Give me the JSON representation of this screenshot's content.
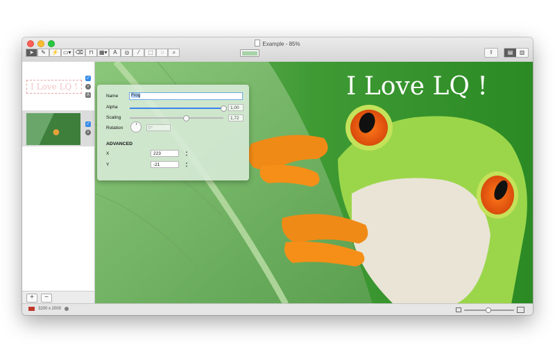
{
  "window": {
    "title": "Example - 85%"
  },
  "toolbar": {
    "tools": [
      {
        "name": "select-tool",
        "glyph": "➤"
      },
      {
        "name": "pencil-tool",
        "glyph": "✎"
      },
      {
        "name": "brush-tool",
        "glyph": "⚡"
      },
      {
        "name": "shape-tool",
        "glyph": "▭▾"
      },
      {
        "name": "eraser-tool",
        "glyph": "⌫"
      },
      {
        "name": "stamp-tool",
        "glyph": "⊓"
      },
      {
        "name": "gradient-tool",
        "glyph": "▦▾"
      },
      {
        "name": "text-tool",
        "glyph": "A"
      },
      {
        "name": "blur-tool",
        "glyph": "◎"
      },
      {
        "name": "eyedropper-tool",
        "glyph": "⁄"
      },
      {
        "name": "marquee-tool",
        "glyph": "⬚"
      },
      {
        "name": "lasso-tool",
        "glyph": "◌"
      },
      {
        "name": "zoom-tool",
        "glyph": "⌕"
      }
    ],
    "color": "#a7d2a8",
    "share_glyph": "⇪",
    "pane_left_glyph": "▤",
    "pane_right_glyph": "▥"
  },
  "canvas": {
    "overlay_text": "I Love LQ !"
  },
  "sidebar": {
    "text_layer": "I Love LQ !",
    "add_label": "+",
    "remove_label": "−",
    "check_glyph": "✓",
    "magnify_glyph": "⌕",
    "font_glyph": "A"
  },
  "inspector": {
    "name_label": "Name",
    "name_value": "Frog",
    "alpha_label": "Alpha",
    "alpha_value": "1,00",
    "alpha_fraction": 1.0,
    "scaling_label": "Scaling",
    "scaling_value": "1,72",
    "scaling_fraction": 0.6,
    "rotation_label": "Rotation",
    "rotation_value": "0°",
    "advanced_label": "ADVANCED",
    "x_label": "X",
    "x_value": "223",
    "y_label": "Y",
    "y_value": "-21",
    "step_up": "▲",
    "step_down": "▼"
  },
  "status": {
    "dimensions": "3200 x 2000",
    "zoom_fraction": 0.47
  }
}
